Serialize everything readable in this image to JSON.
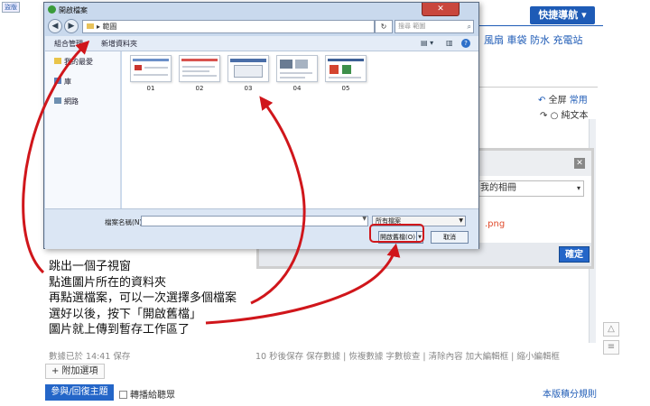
{
  "background_page": {
    "logo_text": "盜版",
    "quick_nav": "快捷導航",
    "category_links": "風扇 車袋 防水 充電站",
    "editor_links": {
      "fullscreen": "全屏",
      "common": "常用",
      "plaintext": "純文本"
    },
    "album_select": "我的相冊",
    "png_text": ".png",
    "confirm_button": "確定",
    "autosave_status": "數據已於 14:41 保存",
    "editor_actions": "10 秒後保存 保存數據 | 恢複數據    字數檢查 | 清除內容    加大編輯框 | 縮小編輯框",
    "add_option": "+ 附加選項",
    "reply_button": "參與/回復主題",
    "broadcast_label": "轉播給聽眾",
    "rules_link": "本版積分規則"
  },
  "file_dialog": {
    "title": "開啟檔案",
    "address_path": "範圖",
    "search_placeholder": "搜尋 範圖",
    "toolbar": {
      "organize": "組合管理 ▾",
      "new_folder": "新增資料夾"
    },
    "nav_items": [
      "我的最愛",
      "庫",
      "網路"
    ],
    "thumbnails": [
      "01",
      "02",
      "03",
      "04",
      "05"
    ],
    "filename_label": "檔案名稱(N):",
    "filetype": "所有檔案",
    "open_button": "開啟舊檔(O)",
    "cancel_button": "取消"
  },
  "annotation": {
    "lines": [
      "跳出一個子視窗",
      "點進圖片所在的資料夾",
      "再點選檔案，可以一次選擇多個檔案",
      "選好以後，按下「開啟舊檔」",
      "圖片就上傳到暫存工作區了"
    ],
    "color": "#d0161b"
  }
}
